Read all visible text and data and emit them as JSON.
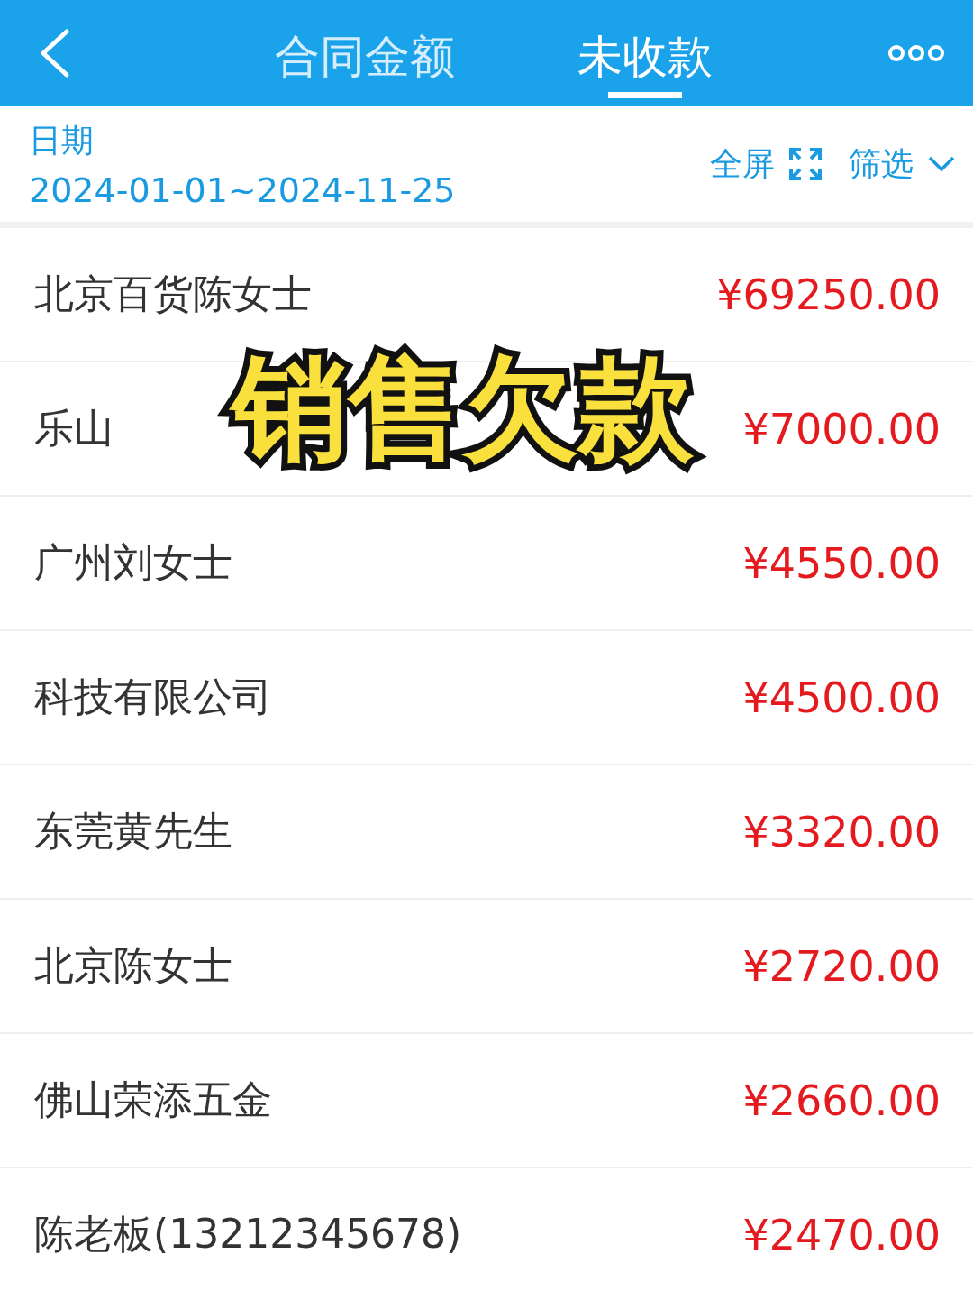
{
  "header": {
    "tabs": [
      {
        "label": "合同金额",
        "selected": false
      },
      {
        "label": "未收款",
        "selected": true
      }
    ]
  },
  "filter_bar": {
    "date_label": "日期",
    "date_range": "2024-01-01~2024-11-25",
    "fullscreen": "全屏",
    "filter": "筛选"
  },
  "rows": [
    {
      "name": "北京百货陈女士",
      "amount": "¥69250.00"
    },
    {
      "name": "乐山",
      "amount": "¥7000.00"
    },
    {
      "name": "广州刘女士",
      "amount": "¥4550.00"
    },
    {
      "name": "科技有限公司",
      "amount": "¥4500.00"
    },
    {
      "name": "东莞黄先生",
      "amount": "¥3320.00"
    },
    {
      "name": "北京陈女士",
      "amount": "¥2720.00"
    },
    {
      "name": "佛山荣添五金",
      "amount": "¥2660.00"
    },
    {
      "name": "陈老板(13212345678)",
      "amount": "¥2470.00"
    }
  ],
  "caption": "销售欠款"
}
